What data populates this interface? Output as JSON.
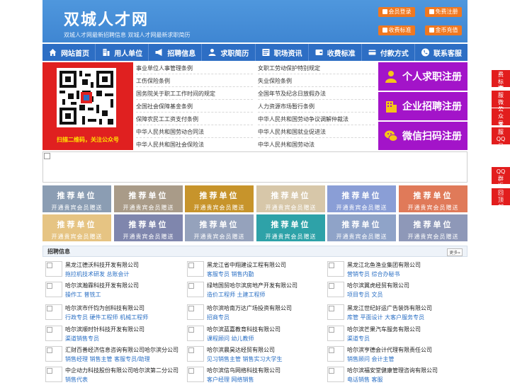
{
  "header": {
    "logo": "双城人才网",
    "subtitle": "双城人才网最新招聘信息   双城人才网最新求职简历",
    "buttons": [
      "会员登录",
      "免费注册",
      "收费标准",
      "金币充值"
    ],
    "brand_color": "#3f86d2",
    "accent_color": "#f07820"
  },
  "nav": [
    {
      "label": "网站首页",
      "icon": "home-icon"
    },
    {
      "label": "用人单位",
      "icon": "building-icon"
    },
    {
      "label": "招聘信息",
      "icon": "megaphone-icon"
    },
    {
      "label": "求职简历",
      "icon": "user-card-icon"
    },
    {
      "label": "职场资讯",
      "icon": "news-icon"
    },
    {
      "label": "收费标准",
      "icon": "wallet-icon"
    },
    {
      "label": "付款方式",
      "icon": "card-icon"
    },
    {
      "label": "联系客服",
      "icon": "phone-icon"
    }
  ],
  "qr_caption": "扫描二维码，关注公众号",
  "laws_left": [
    "事业单位人事管理条例",
    "工伤保险条例",
    "国务院关于职工工作时间的规定",
    "全国社会保障基金条例",
    "保障农民工工资支付条例",
    "中华人民共和国劳动合同法",
    "中华人民共和国社会保险法"
  ],
  "laws_right": [
    "女职工劳动保护特别规定",
    "失业保险条例",
    "全国年节及纪念日放假办法",
    "人力资源市场暂行条例",
    "中华人民共和国劳动争议调解仲裁法",
    "中华人民共和国就业促进法",
    "中华人民共和国劳动法"
  ],
  "register": [
    {
      "label": "个人求职注册",
      "icon": "person-icon"
    },
    {
      "label": "企业招聘注册",
      "icon": "company-icon"
    },
    {
      "label": "微信扫码注册",
      "icon": "wechat-icon"
    }
  ],
  "recommend": {
    "line1": "推荐单位",
    "line2": "开通贵宾会员赠送",
    "colors": [
      "#8b9db3",
      "#a99b88",
      "#c7942b",
      "#d7c7a9",
      "#8a9ed6",
      "#e07a59",
      "#e6c483",
      "#7f86ad",
      "#95a2bc",
      "#2ea2a8",
      "#8fa3c8",
      "#8e98b8"
    ]
  },
  "jobs": {
    "title": "招聘信息",
    "more": "更多»",
    "items": [
      {
        "company": "黑龙江德沃科技开发有限公司",
        "positions": "拖拉机技术研发 总账会计"
      },
      {
        "company": "黑龙江省中翔建设工程有限公司",
        "positions": "客服专员 销售内勤"
      },
      {
        "company": "黑龙江北鱼渔业集团有限公司",
        "positions": "营销专员 综合办秘书"
      },
      {
        "company": "哈尔滨瀚霖科技开发有限公司",
        "positions": "操作工 普铣工"
      },
      {
        "company": "绿地国贸哈尔滨房地产开发有限公司",
        "positions": "造价工程师 土建工程师"
      },
      {
        "company": "哈尔滨翼虎经贸有限公司",
        "positions": "项目专员 文员"
      },
      {
        "company": "哈尔滨市仟钧为创科技有限公司",
        "positions": "行政专员 硬件工程师 机械工程师"
      },
      {
        "company": "哈尔滨哈南万达广场投资有限公司",
        "positions": "招商专员"
      },
      {
        "company": "黑龙江世纪好运广告装饰有限公司",
        "positions": "库管 平面设计 大客户服务专员"
      },
      {
        "company": "哈尔滨顺时针科技开发有限公司",
        "positions": "渠道销售专员"
      },
      {
        "company": "哈尔滨蓝嘉教育科技有限公司",
        "positions": "课程顾问 幼儿教师"
      },
      {
        "company": "哈尔滨芒果汽车服务有限公司",
        "positions": "渠道专员"
      },
      {
        "company": "汇财百善经济信息咨询有限公司哈尔滨分公司",
        "positions": "销售经理 销售主管 客服专员/助理"
      },
      {
        "company": "哈尔滨晨昊达经贸有限公司",
        "positions": "见习销售主管 销售实习大学生"
      },
      {
        "company": "哈尔滨亨德会计代理有限责任公司",
        "positions": "销售顾问 会计主管"
      },
      {
        "company": "中企动力科技股份有限公司哈尔滨第二分公司",
        "positions": "销售代表"
      },
      {
        "company": "哈尔滨信鸟网络科技有限公司",
        "positions": "客户经理 网络销售"
      },
      {
        "company": "哈尔滨福安堂健康管理咨询有限公司",
        "positions": "电话销售 客服"
      }
    ]
  },
  "float_menu": [
    "收费标准",
    "客服微信",
    "公众号",
    "客服QQ号",
    "QQ群",
    "返回顶部"
  ]
}
